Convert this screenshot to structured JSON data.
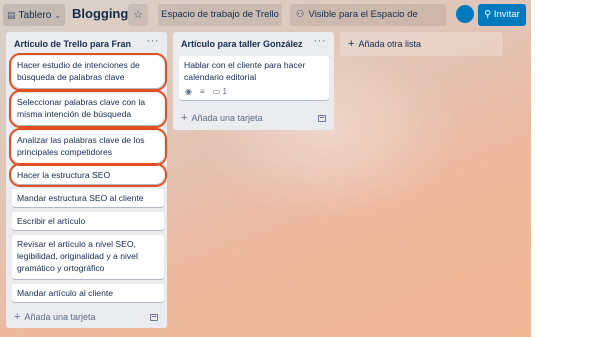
{
  "header": {
    "view_label": "Tablero",
    "view_icon": "board-icon",
    "board_title": "Blogging",
    "star_icon": "☆",
    "workspace_label": "Espacio de trabajo de Trello",
    "visibility_icon": "people-icon",
    "visibility_label": "Visible para el Espacio de trabajo",
    "invite_label": "Invitar",
    "invite_icon": "person-add-icon",
    "accent_color": "#0079bf"
  },
  "lists": [
    {
      "title": "Artículo de Trello para Fran",
      "menu": "···",
      "cards": [
        {
          "text": "Hacer estudio de intenciones de búsqueda de palabras clave",
          "highlighted": true
        },
        {
          "text": "Seleccionar palabras clave con la misma intención de búsqueda",
          "highlighted": true
        },
        {
          "text": "Analizar las palabras clave de los principales competidores",
          "highlighted": true
        },
        {
          "text": "Hacer la estructura SEO",
          "highlighted": true
        },
        {
          "text": "Mandar estructura SEO al cliente",
          "highlighted": false
        },
        {
          "text": "Escribir el artículo",
          "highlighted": false
        },
        {
          "text": "Revisar el artículo a nivel SEO, legibilidad, originalidad y a nivel gramático y ortográfico",
          "highlighted": false
        },
        {
          "text": "Mandar artículo al cliente",
          "highlighted": false
        }
      ],
      "add_card_label": "Añada una tarjeta"
    },
    {
      "title": "Artículo para taller González",
      "menu": "···",
      "cards": [
        {
          "text": "Hablar con el cliente para hacer calendario editorial",
          "highlighted": false,
          "comment_count": "1"
        }
      ],
      "add_card_label": "Añada una tarjeta"
    }
  ],
  "add_list_label": "Añada otra lista",
  "highlight_color": "#e34f21"
}
